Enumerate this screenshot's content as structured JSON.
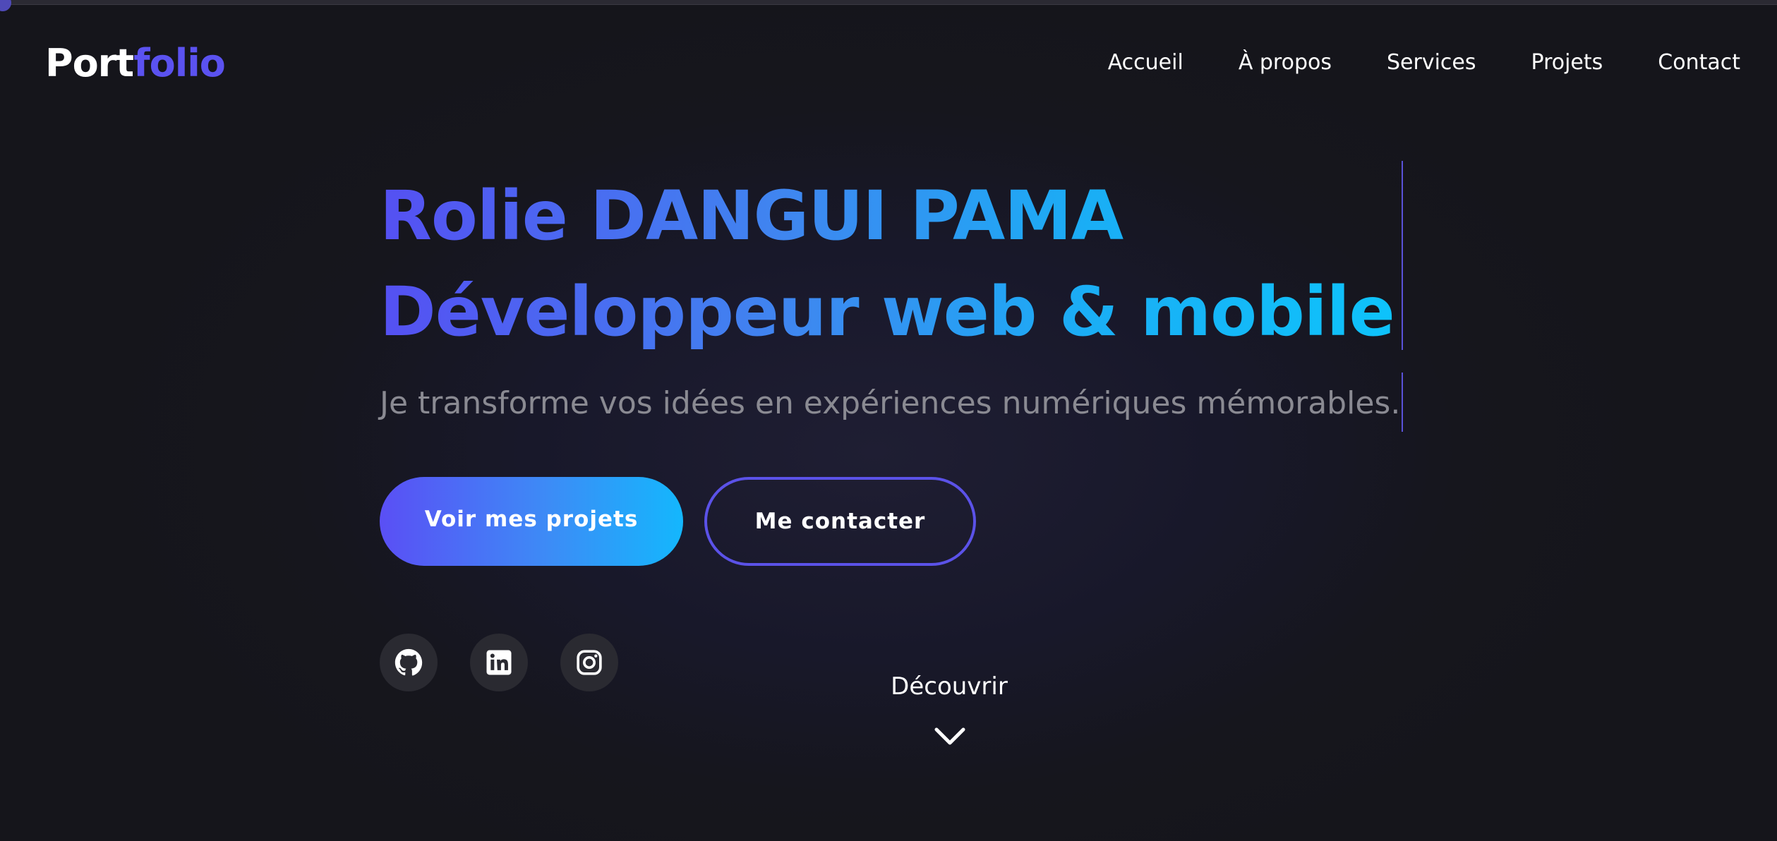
{
  "header": {
    "logo_part1": "Port",
    "logo_part2": "folio",
    "nav": [
      "Accueil",
      "À propos",
      "Services",
      "Projets",
      "Contact"
    ]
  },
  "hero": {
    "name": "Rolie DANGUI PAMA",
    "role": "Développeur web & mobile",
    "tagline": "Je transforme vos idées en expériences numériques mémorables.",
    "primary_button": "Voir mes projets",
    "secondary_button": "Me contacter"
  },
  "social": [
    {
      "icon": "github-icon"
    },
    {
      "icon": "linkedin-icon"
    },
    {
      "icon": "instagram-icon"
    }
  ],
  "scroll": {
    "label": "Découvrir",
    "icon": "chevron-down-icon"
  },
  "colors": {
    "background": "#15151c",
    "accent_purple": "#5b52f0",
    "accent_cyan": "#0ec3fb",
    "muted_text": "#8a8a92",
    "social_bg": "#2a2a31"
  }
}
